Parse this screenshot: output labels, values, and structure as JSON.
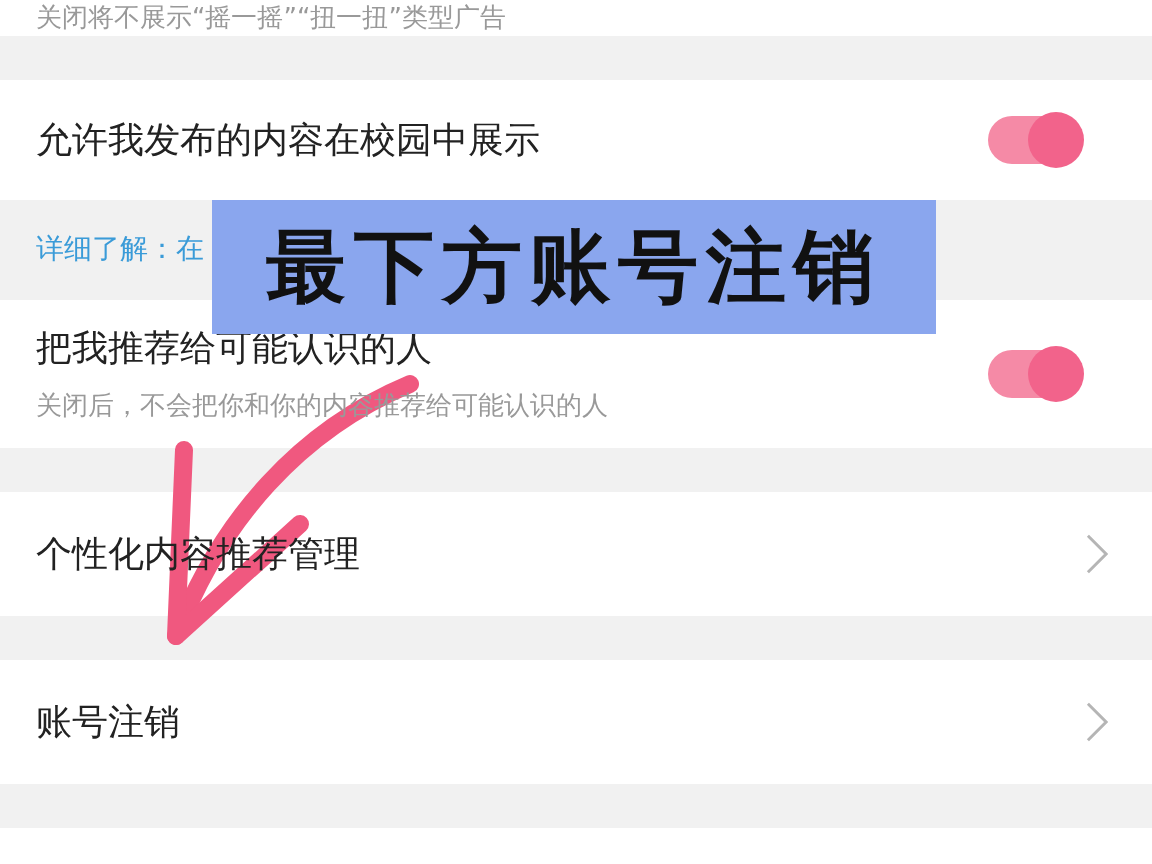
{
  "top_caption": "关闭将不展示“摇一摇”“扭一扭”类型广告",
  "settings": [
    {
      "kind": "toggle",
      "title": "允许我发布的内容在校园中展示",
      "on": true
    },
    {
      "kind": "link",
      "text": "详细了解：在"
    },
    {
      "kind": "toggle",
      "title": "把我推荐给可能认识的人",
      "subtitle": "关闭后，不会把你和你的内容推荐给可能认识的人",
      "on": true
    },
    {
      "kind": "nav",
      "title": "个性化内容推荐管理"
    },
    {
      "kind": "nav",
      "title": "账号注销"
    }
  ],
  "banner": "最下方账号注销"
}
